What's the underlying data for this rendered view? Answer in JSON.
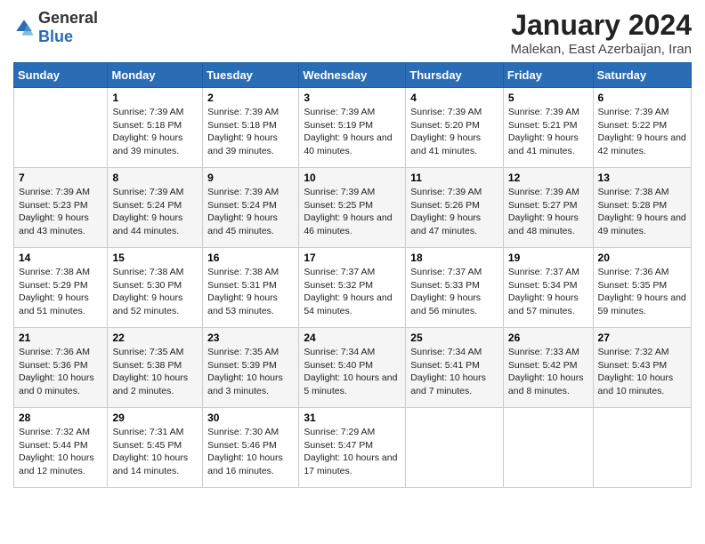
{
  "logo": {
    "text_general": "General",
    "text_blue": "Blue"
  },
  "title": "January 2024",
  "subtitle": "Malekan, East Azerbaijan, Iran",
  "headers": [
    "Sunday",
    "Monday",
    "Tuesday",
    "Wednesday",
    "Thursday",
    "Friday",
    "Saturday"
  ],
  "weeks": [
    [
      {
        "day": "",
        "sunrise": "",
        "sunset": "",
        "daylight": ""
      },
      {
        "day": "1",
        "sunrise": "Sunrise: 7:39 AM",
        "sunset": "Sunset: 5:18 PM",
        "daylight": "Daylight: 9 hours and 39 minutes."
      },
      {
        "day": "2",
        "sunrise": "Sunrise: 7:39 AM",
        "sunset": "Sunset: 5:18 PM",
        "daylight": "Daylight: 9 hours and 39 minutes."
      },
      {
        "day": "3",
        "sunrise": "Sunrise: 7:39 AM",
        "sunset": "Sunset: 5:19 PM",
        "daylight": "Daylight: 9 hours and 40 minutes."
      },
      {
        "day": "4",
        "sunrise": "Sunrise: 7:39 AM",
        "sunset": "Sunset: 5:20 PM",
        "daylight": "Daylight: 9 hours and 41 minutes."
      },
      {
        "day": "5",
        "sunrise": "Sunrise: 7:39 AM",
        "sunset": "Sunset: 5:21 PM",
        "daylight": "Daylight: 9 hours and 41 minutes."
      },
      {
        "day": "6",
        "sunrise": "Sunrise: 7:39 AM",
        "sunset": "Sunset: 5:22 PM",
        "daylight": "Daylight: 9 hours and 42 minutes."
      }
    ],
    [
      {
        "day": "7",
        "sunrise": "Sunrise: 7:39 AM",
        "sunset": "Sunset: 5:23 PM",
        "daylight": "Daylight: 9 hours and 43 minutes."
      },
      {
        "day": "8",
        "sunrise": "Sunrise: 7:39 AM",
        "sunset": "Sunset: 5:24 PM",
        "daylight": "Daylight: 9 hours and 44 minutes."
      },
      {
        "day": "9",
        "sunrise": "Sunrise: 7:39 AM",
        "sunset": "Sunset: 5:24 PM",
        "daylight": "Daylight: 9 hours and 45 minutes."
      },
      {
        "day": "10",
        "sunrise": "Sunrise: 7:39 AM",
        "sunset": "Sunset: 5:25 PM",
        "daylight": "Daylight: 9 hours and 46 minutes."
      },
      {
        "day": "11",
        "sunrise": "Sunrise: 7:39 AM",
        "sunset": "Sunset: 5:26 PM",
        "daylight": "Daylight: 9 hours and 47 minutes."
      },
      {
        "day": "12",
        "sunrise": "Sunrise: 7:39 AM",
        "sunset": "Sunset: 5:27 PM",
        "daylight": "Daylight: 9 hours and 48 minutes."
      },
      {
        "day": "13",
        "sunrise": "Sunrise: 7:38 AM",
        "sunset": "Sunset: 5:28 PM",
        "daylight": "Daylight: 9 hours and 49 minutes."
      }
    ],
    [
      {
        "day": "14",
        "sunrise": "Sunrise: 7:38 AM",
        "sunset": "Sunset: 5:29 PM",
        "daylight": "Daylight: 9 hours and 51 minutes."
      },
      {
        "day": "15",
        "sunrise": "Sunrise: 7:38 AM",
        "sunset": "Sunset: 5:30 PM",
        "daylight": "Daylight: 9 hours and 52 minutes."
      },
      {
        "day": "16",
        "sunrise": "Sunrise: 7:38 AM",
        "sunset": "Sunset: 5:31 PM",
        "daylight": "Daylight: 9 hours and 53 minutes."
      },
      {
        "day": "17",
        "sunrise": "Sunrise: 7:37 AM",
        "sunset": "Sunset: 5:32 PM",
        "daylight": "Daylight: 9 hours and 54 minutes."
      },
      {
        "day": "18",
        "sunrise": "Sunrise: 7:37 AM",
        "sunset": "Sunset: 5:33 PM",
        "daylight": "Daylight: 9 hours and 56 minutes."
      },
      {
        "day": "19",
        "sunrise": "Sunrise: 7:37 AM",
        "sunset": "Sunset: 5:34 PM",
        "daylight": "Daylight: 9 hours and 57 minutes."
      },
      {
        "day": "20",
        "sunrise": "Sunrise: 7:36 AM",
        "sunset": "Sunset: 5:35 PM",
        "daylight": "Daylight: 9 hours and 59 minutes."
      }
    ],
    [
      {
        "day": "21",
        "sunrise": "Sunrise: 7:36 AM",
        "sunset": "Sunset: 5:36 PM",
        "daylight": "Daylight: 10 hours and 0 minutes."
      },
      {
        "day": "22",
        "sunrise": "Sunrise: 7:35 AM",
        "sunset": "Sunset: 5:38 PM",
        "daylight": "Daylight: 10 hours and 2 minutes."
      },
      {
        "day": "23",
        "sunrise": "Sunrise: 7:35 AM",
        "sunset": "Sunset: 5:39 PM",
        "daylight": "Daylight: 10 hours and 3 minutes."
      },
      {
        "day": "24",
        "sunrise": "Sunrise: 7:34 AM",
        "sunset": "Sunset: 5:40 PM",
        "daylight": "Daylight: 10 hours and 5 minutes."
      },
      {
        "day": "25",
        "sunrise": "Sunrise: 7:34 AM",
        "sunset": "Sunset: 5:41 PM",
        "daylight": "Daylight: 10 hours and 7 minutes."
      },
      {
        "day": "26",
        "sunrise": "Sunrise: 7:33 AM",
        "sunset": "Sunset: 5:42 PM",
        "daylight": "Daylight: 10 hours and 8 minutes."
      },
      {
        "day": "27",
        "sunrise": "Sunrise: 7:32 AM",
        "sunset": "Sunset: 5:43 PM",
        "daylight": "Daylight: 10 hours and 10 minutes."
      }
    ],
    [
      {
        "day": "28",
        "sunrise": "Sunrise: 7:32 AM",
        "sunset": "Sunset: 5:44 PM",
        "daylight": "Daylight: 10 hours and 12 minutes."
      },
      {
        "day": "29",
        "sunrise": "Sunrise: 7:31 AM",
        "sunset": "Sunset: 5:45 PM",
        "daylight": "Daylight: 10 hours and 14 minutes."
      },
      {
        "day": "30",
        "sunrise": "Sunrise: 7:30 AM",
        "sunset": "Sunset: 5:46 PM",
        "daylight": "Daylight: 10 hours and 16 minutes."
      },
      {
        "day": "31",
        "sunrise": "Sunrise: 7:29 AM",
        "sunset": "Sunset: 5:47 PM",
        "daylight": "Daylight: 10 hours and 17 minutes."
      },
      {
        "day": "",
        "sunrise": "",
        "sunset": "",
        "daylight": ""
      },
      {
        "day": "",
        "sunrise": "",
        "sunset": "",
        "daylight": ""
      },
      {
        "day": "",
        "sunrise": "",
        "sunset": "",
        "daylight": ""
      }
    ]
  ]
}
